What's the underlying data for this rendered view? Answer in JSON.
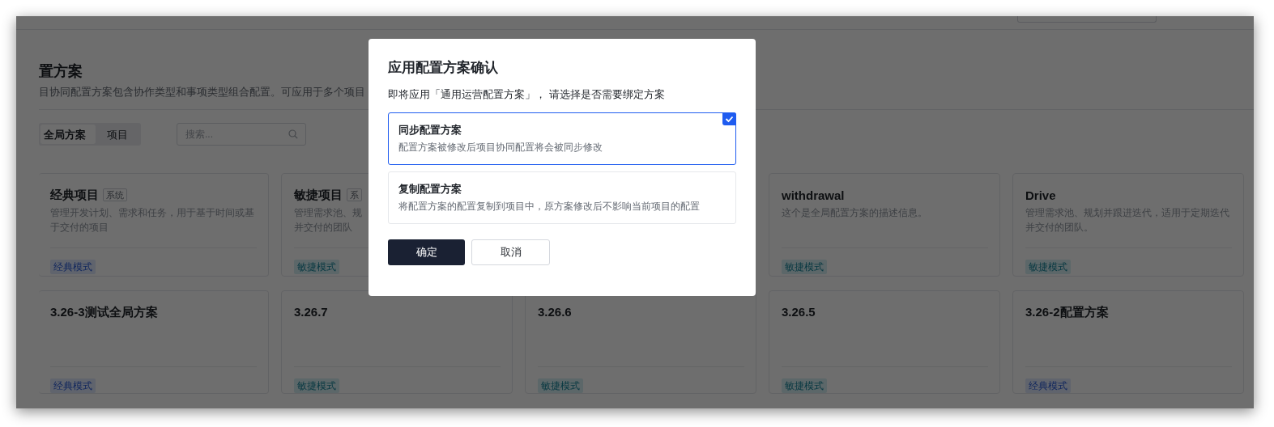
{
  "page": {
    "title": "置方案",
    "description": "目协同配置方案包含协作类型和事项类型组合配置。可应用于多个项目"
  },
  "scope_tabs": [
    {
      "label": "全局方案",
      "selected": true
    },
    {
      "label": "项目",
      "selected": false
    }
  ],
  "search": {
    "placeholder": "搜索..."
  },
  "card_rows": [
    [
      {
        "title": "经典项目",
        "badge": "系统",
        "description_lines": [
          "管理开发计划、需求和任务，用于基于时间或基",
          "于交付的项目"
        ],
        "tag": {
          "label": "经典模式",
          "kind": "classic"
        }
      },
      {
        "title": "敏捷项目",
        "badge": "系",
        "description_lines": [
          "管理需求池、规",
          "并交付的团队"
        ],
        "tag": {
          "label": "敏捷模式",
          "kind": "agile"
        }
      },
      null,
      {
        "title": "withdrawal",
        "description_lines": [
          "这个是全局配置方案的描述信息。"
        ],
        "tag": {
          "label": "敏捷模式",
          "kind": "agile"
        }
      },
      {
        "title": "Drive",
        "description_lines": [
          "管理需求池、规划并跟进迭代，适用于定期迭代",
          "并交付的团队。"
        ],
        "tag": {
          "label": "敏捷模式",
          "kind": "agile"
        }
      }
    ],
    [
      {
        "title": "3.26-3测试全局方案",
        "tag": {
          "label": "经典模式",
          "kind": "classic"
        }
      },
      {
        "title": "3.26.7",
        "tag": {
          "label": "敏捷模式",
          "kind": "agile"
        }
      },
      {
        "title": "3.26.6",
        "tag": {
          "label": "敏捷模式",
          "kind": "agile"
        }
      },
      {
        "title": "3.26.5",
        "tag": {
          "label": "敏捷模式",
          "kind": "agile"
        }
      },
      {
        "title": "3.26-2配置方案",
        "tag": {
          "label": "经典模式",
          "kind": "classic"
        }
      }
    ]
  ],
  "dialog": {
    "title": "应用配置方案确认",
    "message": "即将应用「通用运营配置方案」， 请选择是否需要绑定方案",
    "options": [
      {
        "title": "同步配置方案",
        "description": "配置方案被修改后项目协同配置将会被同步修改",
        "selected": true
      },
      {
        "title": "复制配置方案",
        "description": "将配置方案的配置复制到项目中，原方案修改后不影响当前项目的配置",
        "selected": false
      }
    ],
    "confirm": "确定",
    "cancel": "取消"
  }
}
